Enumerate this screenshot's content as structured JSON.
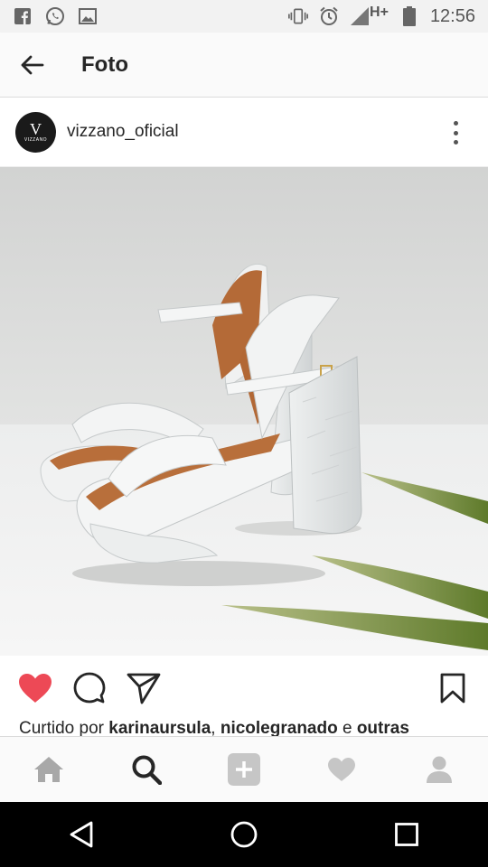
{
  "status_bar": {
    "left_icons": [
      "facebook-icon",
      "whatsapp-icon",
      "gallery-icon"
    ],
    "right_icons": [
      "vibrate-icon",
      "alarm-icon",
      "signal-icon",
      "battery-icon"
    ],
    "network": "H+",
    "time": "12:56"
  },
  "app_bar": {
    "back_icon": "arrow-left-icon",
    "title": "Foto"
  },
  "post": {
    "avatar_letter": "V",
    "avatar_text": "VIZZANO",
    "username": "vizzano_oficial",
    "more_icon": "more-vertical-icon"
  },
  "actions": {
    "like_icon": "heart-filled-icon",
    "comment_icon": "comment-icon",
    "share_icon": "send-icon",
    "save_icon": "bookmark-icon",
    "like_color": "#ed4956"
  },
  "likes": {
    "prefix": "Curtido por ",
    "user1": "karinaursula",
    "sep": ", ",
    "user2": "nicolegranado",
    "conj": " e ",
    "others": "outras"
  },
  "bottom_nav": [
    "home-icon",
    "search-icon",
    "add-icon",
    "heart-icon",
    "profile-icon"
  ],
  "android_nav": [
    "back-triangle-icon",
    "home-circle-icon",
    "recents-square-icon"
  ]
}
